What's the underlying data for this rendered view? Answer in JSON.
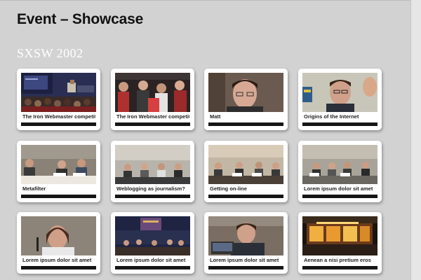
{
  "page": {
    "title": "Event – Showcase"
  },
  "section": {
    "title": "SXSW 2002"
  },
  "gallery": {
    "items": [
      {
        "caption": "The Iron Webmaster competition"
      },
      {
        "caption": "The Iron Webmaster competition"
      },
      {
        "caption": "Matt"
      },
      {
        "caption": "Origins of the Internet"
      },
      {
        "caption": "Metafilter"
      },
      {
        "caption": "Weblogging as journalism?"
      },
      {
        "caption": "Getting on-line"
      },
      {
        "caption": "Lorem ipsum dolor sit amet"
      },
      {
        "caption": "Lorem ipsum dolor sit amet"
      },
      {
        "caption": "Lorem ipsum dolor sit amet"
      },
      {
        "caption": "Lorem ipsum dolor sit amet"
      },
      {
        "caption": "Aenean a nisi pretium eros"
      }
    ]
  }
}
